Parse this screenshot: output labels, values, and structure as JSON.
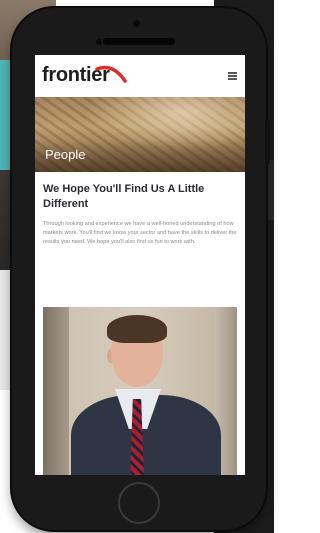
{
  "page": {
    "logo_text": "frontier",
    "hero_title": "People",
    "headline": "We Hope You'll Find Us A Little Different",
    "body": "Through looking and experience we have a well-honed understanding of how markets work. You'll find we know your sector and have the skills to deliver the results you need. We hope you'll also find us fun to work with.",
    "menu_icon": "hamburger-menu-icon"
  },
  "colors": {
    "logo_accent": "#d9302b",
    "headline": "#2a2a3a",
    "body_text": "#8a8a8a",
    "device": "#1a1a1a"
  }
}
